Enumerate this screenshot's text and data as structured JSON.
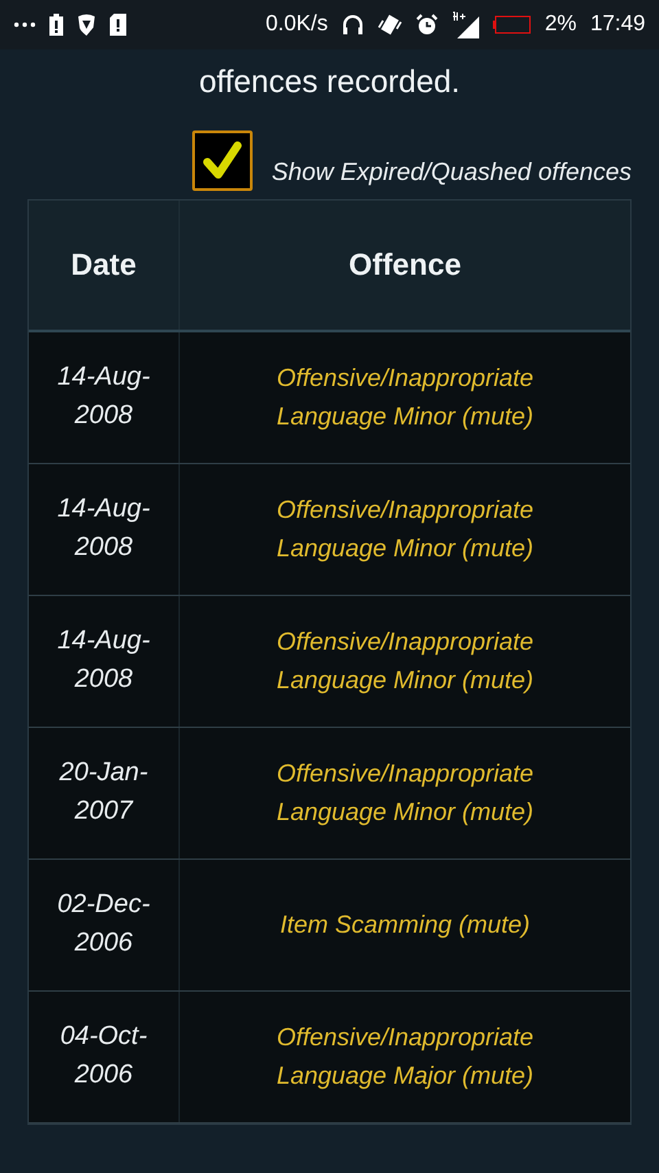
{
  "status_bar": {
    "network_speed": "0.0K/s",
    "battery_percent": "2%",
    "time": "17:49"
  },
  "heading": "offences recorded.",
  "show_expired": {
    "label": "Show Expired/Quashed offences",
    "checked": true
  },
  "table": {
    "columns": [
      "Date",
      "Offence"
    ],
    "rows": [
      {
        "date": "14-Aug-2008",
        "offence": "Offensive/Inappropriate Language Minor (mute)"
      },
      {
        "date": "14-Aug-2008",
        "offence": "Offensive/Inappropriate Language Minor (mute)"
      },
      {
        "date": "14-Aug-2008",
        "offence": "Offensive/Inappropriate Language Minor (mute)"
      },
      {
        "date": "20-Jan-2007",
        "offence": "Offensive/Inappropriate Language Minor (mute)"
      },
      {
        "date": "02-Dec-2006",
        "offence": "Item Scamming (mute)"
      },
      {
        "date": "04-Oct-2006",
        "offence": "Offensive/Inappropriate Language Major (mute)"
      }
    ]
  }
}
